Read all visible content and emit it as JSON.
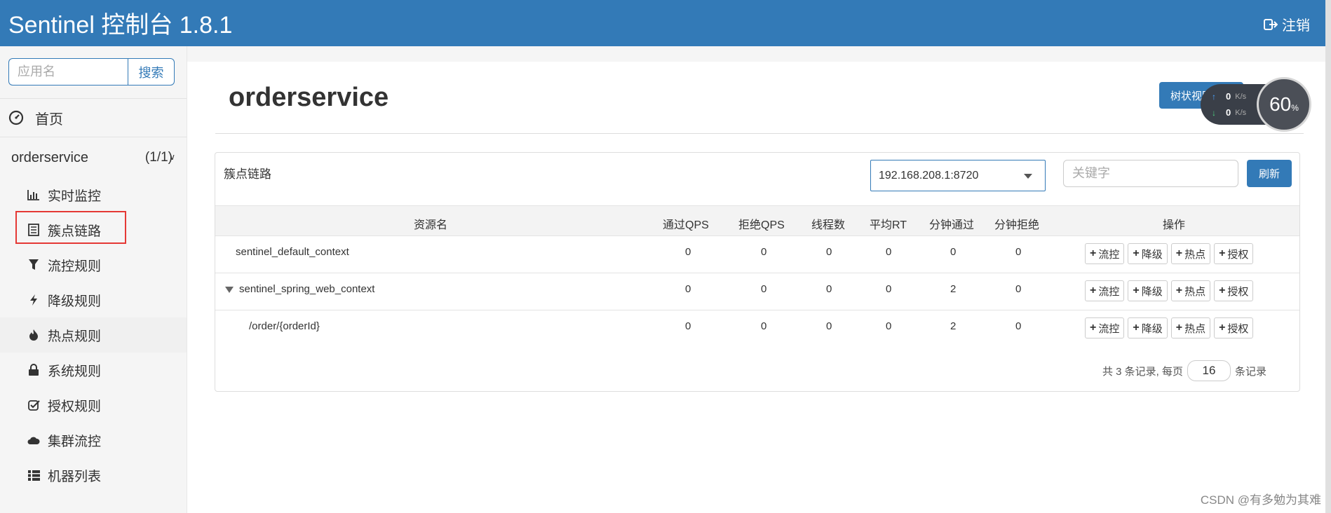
{
  "header": {
    "brand": "Sentinel 控制台 1.8.1",
    "logout_label": "注销",
    "color": "#337ab7"
  },
  "sidebar": {
    "search_placeholder": "应用名",
    "search_button": "搜索",
    "home_label": "首页",
    "app_name": "orderservice",
    "app_count": "(1/1)",
    "items": [
      {
        "label": "实时监控",
        "icon": "bar-chart-icon"
      },
      {
        "label": "簇点链路",
        "icon": "list-icon"
      },
      {
        "label": "流控规则",
        "icon": "filter-icon"
      },
      {
        "label": "降级规则",
        "icon": "bolt-icon"
      },
      {
        "label": "热点规则",
        "icon": "fire-icon"
      },
      {
        "label": "系统规则",
        "icon": "lock-icon"
      },
      {
        "label": "授权规则",
        "icon": "check-square-icon"
      },
      {
        "label": "集群流控",
        "icon": "cloud-icon"
      },
      {
        "label": "机器列表",
        "icon": "th-list-icon"
      }
    ]
  },
  "main": {
    "title": "orderservice",
    "tree_view_button": "树状视图",
    "net_widget": {
      "up": "0",
      "down": "0",
      "unit": "K/s",
      "percent": "60",
      "percent_sign": "%"
    },
    "panel": {
      "title": "簇点链路",
      "machine_selected": "192.168.208.1:8720",
      "keyword_placeholder": "关键字",
      "refresh_button": "刷新",
      "columns": [
        "资源名",
        "通过QPS",
        "拒绝QPS",
        "线程数",
        "平均RT",
        "分钟通过",
        "分钟拒绝",
        "操作"
      ],
      "rows": [
        {
          "name": "sentinel_default_context",
          "pass_qps": "0",
          "block_qps": "0",
          "threads": "0",
          "avg_rt": "0",
          "minute_pass": "0",
          "minute_block": "0"
        },
        {
          "name": "sentinel_spring_web_context",
          "pass_qps": "0",
          "block_qps": "0",
          "threads": "0",
          "avg_rt": "0",
          "minute_pass": "2",
          "minute_block": "0"
        },
        {
          "name": "/order/{orderId}",
          "pass_qps": "0",
          "block_qps": "0",
          "threads": "0",
          "avg_rt": "0",
          "minute_pass": "2",
          "minute_block": "0"
        }
      ],
      "actions": [
        "流控",
        "降级",
        "热点",
        "授权"
      ],
      "pager": {
        "prefix": "共 3 条记录, 每页",
        "page_size": "16",
        "suffix": "条记录"
      }
    }
  },
  "watermark": "CSDN @有多勉为其难"
}
